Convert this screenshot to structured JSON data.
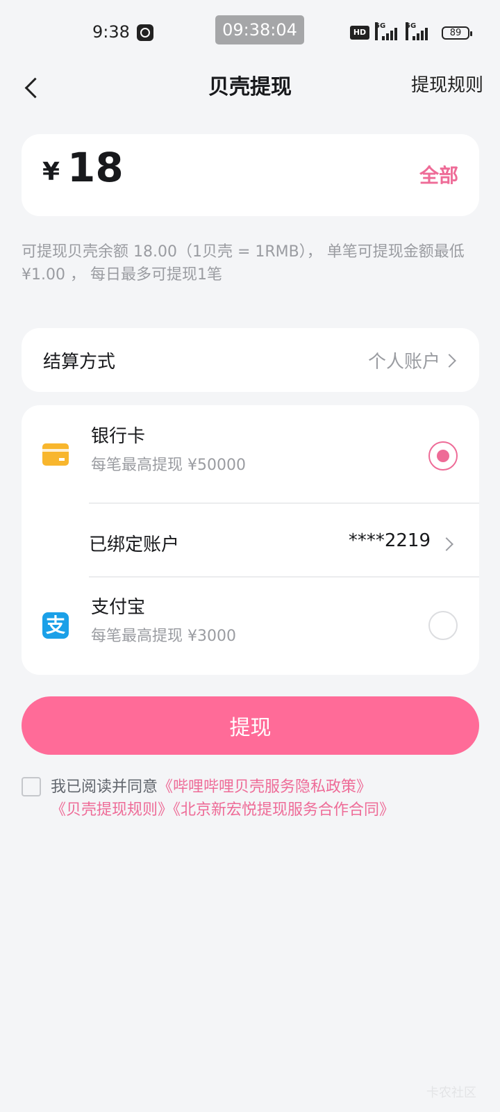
{
  "status_bar": {
    "time": "9:38",
    "overlay_time": "09:38:04",
    "hd_label": "HD",
    "signal_1": "5G",
    "signal_2": "5G",
    "battery": "89"
  },
  "nav": {
    "title": "贝壳提现",
    "rule_link": "提现规则"
  },
  "amount": {
    "currency": "¥",
    "value": "18",
    "all_button": "全部"
  },
  "hint": {
    "line1": "可提现贝壳余额 18.00（1贝壳 = 1RMB）， 单笔可提现金额最低",
    "line2": "¥1.00 ， 每日最多可提现1笔"
  },
  "settlement": {
    "label": "结算方式",
    "value": "个人账户"
  },
  "methods": {
    "bank": {
      "title": "银行卡",
      "subtitle": "每笔最高提现 ¥50000",
      "selected": true
    },
    "bound": {
      "label": "已绑定账户",
      "value": "****2219"
    },
    "alipay": {
      "title": "支付宝",
      "subtitle": "每笔最高提现 ¥3000",
      "icon_glyph": "支",
      "selected": false
    }
  },
  "withdraw_button": "提现",
  "agreement": {
    "prefix": "我已阅读并同意",
    "link1": "《哔哩哔哩贝壳服务隐私政策》",
    "link2": "《贝壳提现规则》",
    "link3": "《北京新宏悦提现服务合作合同》"
  },
  "colors": {
    "accent": "#ff6b98",
    "accent_text": "#ee6b97",
    "bank_icon": "#f8b62d",
    "alipay_icon": "#1ba0e8"
  }
}
